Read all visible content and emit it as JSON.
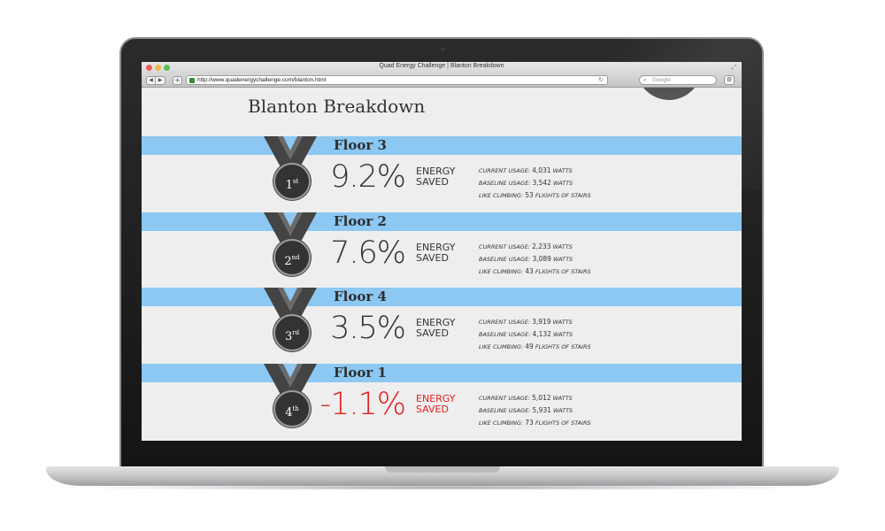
{
  "browser": {
    "window_title": "Quad Energy Challenge | Blanton Breakdown",
    "url": "http://www.quadenergychallenge.com/blanton.html",
    "search_placeholder": "Google",
    "back_glyph": "◀",
    "forward_glyph": "▶",
    "add_glyph": "+",
    "reload_glyph": "↻",
    "search_glyph": "⌕",
    "gear_glyph": "⚙",
    "expand_glyph": "⤢"
  },
  "page": {
    "title": "Blanton Breakdown"
  },
  "colors": {
    "band": "#8cc8f2",
    "negative": "#e12120",
    "medal": "#333333"
  },
  "floors": [
    {
      "name": "Floor 3",
      "rank": "1",
      "rank_suffix": "st",
      "percent": "9.2%",
      "saved_line1": "ENERGY",
      "saved_line2": "SAVED",
      "current_label": "CURRENT USAGE:",
      "current_value": "4,031",
      "baseline_label": "BASELINE USAGE:",
      "baseline_value": "3,542",
      "unit": "WATTS",
      "climb_label": "LIKE CLIMBING:",
      "climb_value": "53",
      "climb_unit": "FLIGHTS OF STAIRS",
      "negative": false
    },
    {
      "name": "Floor 2",
      "rank": "2",
      "rank_suffix": "nd",
      "percent": "7.6%",
      "saved_line1": "ENERGY",
      "saved_line2": "SAVED",
      "current_label": "CURRENT USAGE:",
      "current_value": "2,233",
      "baseline_label": "BASELINE USAGE:",
      "baseline_value": "3,089",
      "unit": "WATTS",
      "climb_label": "LIKE CLIMBING:",
      "climb_value": "43",
      "climb_unit": "FLIGHTS OF STAIRS",
      "negative": false
    },
    {
      "name": "Floor 4",
      "rank": "3",
      "rank_suffix": "rd",
      "percent": "3.5%",
      "saved_line1": "ENERGY",
      "saved_line2": "SAVED",
      "current_label": "CURRENT USAGE:",
      "current_value": "3,919",
      "baseline_label": "BASELINE USAGE:",
      "baseline_value": "4,132",
      "unit": "WATTS",
      "climb_label": "LIKE CLIMBING:",
      "climb_value": "49",
      "climb_unit": "FLIGHTS OF STAIRS",
      "negative": false
    },
    {
      "name": "Floor 1",
      "rank": "4",
      "rank_suffix": "th",
      "percent": "-1.1%",
      "saved_line1": "ENERGY",
      "saved_line2": "SAVED",
      "current_label": "CURRENT USAGE:",
      "current_value": "5,012",
      "baseline_label": "BASELINE USAGE:",
      "baseline_value": "5,931",
      "unit": "WATTS",
      "climb_label": "LIKE CLIMBING:",
      "climb_value": "73",
      "climb_unit": "FLIGHTS OF STAIRS",
      "negative": true
    }
  ]
}
